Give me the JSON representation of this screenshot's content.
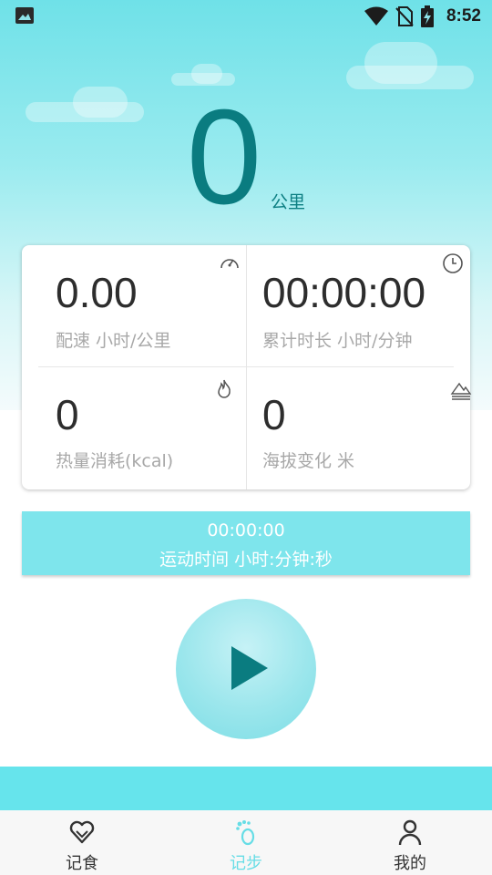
{
  "status_bar": {
    "time": "8:52",
    "icons": [
      "image-icon",
      "wifi-icon",
      "no-sim-icon",
      "battery-charging-icon"
    ]
  },
  "distance": {
    "value": "0",
    "unit": "公里"
  },
  "stats": [
    {
      "value": "0.00",
      "label": "配速  小时/公里",
      "icon": "speedometer-icon"
    },
    {
      "value": "00:00:00",
      "label": "累计时长  小时/分钟",
      "icon": "clock-icon"
    },
    {
      "value": "0",
      "label": "热量消耗(kcal)",
      "icon": "flame-icon"
    },
    {
      "value": "0",
      "label": "海拔变化 米",
      "icon": "mountain-icon"
    }
  ],
  "sport_time": {
    "value": "00:00:00",
    "label": "运动时间 小时:分钟:秒"
  },
  "play_button": {
    "icon": "play-icon"
  },
  "bottom_nav": [
    {
      "label": "记食",
      "icon": "heart-icon",
      "active": false
    },
    {
      "label": "记步",
      "icon": "footprint-icon",
      "active": true
    },
    {
      "label": "我的",
      "icon": "person-icon",
      "active": false
    }
  ],
  "colors": {
    "primary": "#0a7c80",
    "accent": "#66e4ec",
    "time_bar": "#7ee5ec",
    "nav_active": "#66dde6"
  }
}
